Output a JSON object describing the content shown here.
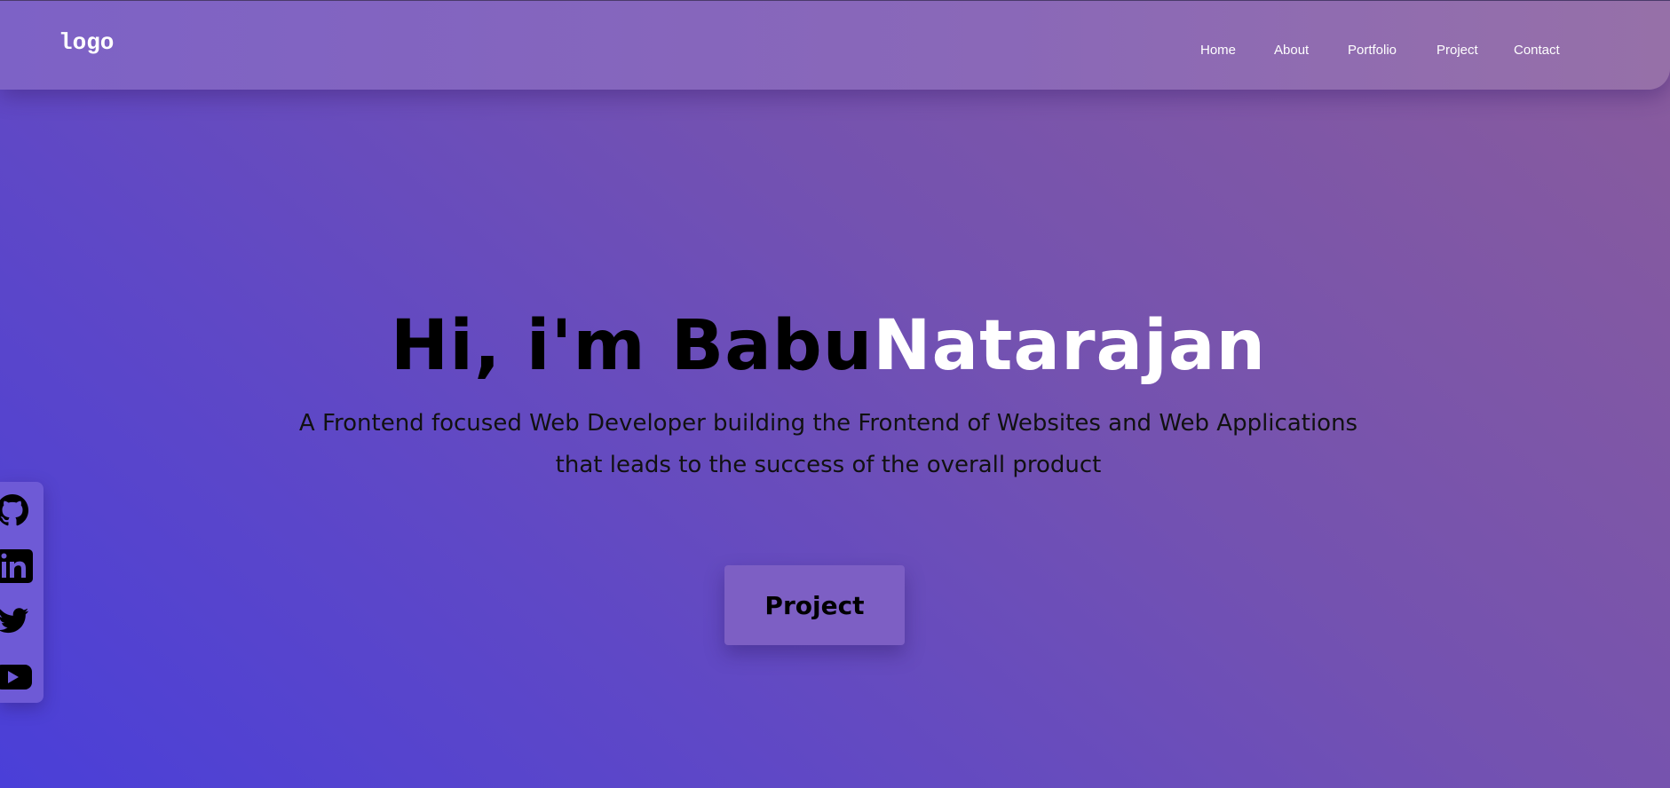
{
  "header": {
    "logo": "logo",
    "nav": [
      "Home",
      "About",
      "Portfolio",
      "Project",
      "Contact"
    ]
  },
  "hero": {
    "title_dark": "Hi, i'm Babu",
    "title_light": "Natarajan",
    "subtitle": "A Frontend focused Web Developer building the Frontend of Websites and Web Applications that leads to the success of the overall product",
    "cta_label": "Project"
  },
  "social": {
    "icons": [
      "github-icon",
      "linkedin-icon",
      "twitter-icon",
      "youtube-icon"
    ]
  },
  "colors": {
    "gradient_start": "#4a3fd8",
    "gradient_end": "#8a5c9c",
    "navbar": "#8a68b8",
    "cta_bg": "#7d5fc4",
    "title_highlight": "#ffffff"
  }
}
